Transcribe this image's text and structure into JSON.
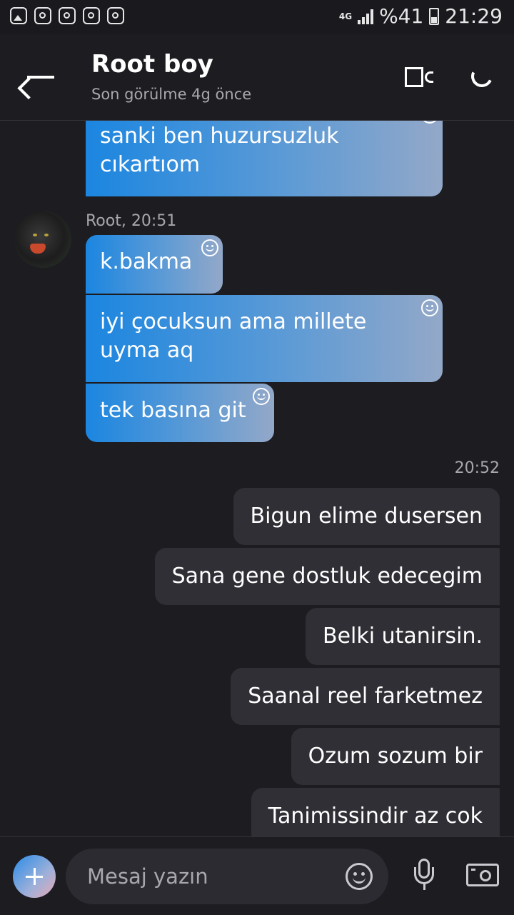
{
  "status_bar": {
    "network": "4G",
    "battery": "%41",
    "time": "21:29"
  },
  "header": {
    "title": "Root boy",
    "subtitle": "Son görülme 4g önce"
  },
  "messages": {
    "in_0": "sanki ben huzursuzluk cıkartıom",
    "sender_meta": "Root, 20:51",
    "in_1": "k.bakma",
    "in_2": "iyi çocuksun ama millete uyma aq",
    "in_3": "tek basına git",
    "out_time": "20:52",
    "out_0": "Bigun elime dusersen",
    "out_1": "Sana gene dostluk edecegim",
    "out_2": "Belki utanirsin.",
    "out_3": "Saanal reel farketmez",
    "out_4": "Ozum sozum bir",
    "out_5": "Tanimissindir az cok"
  },
  "composer": {
    "placeholder": "Mesaj yazın"
  }
}
